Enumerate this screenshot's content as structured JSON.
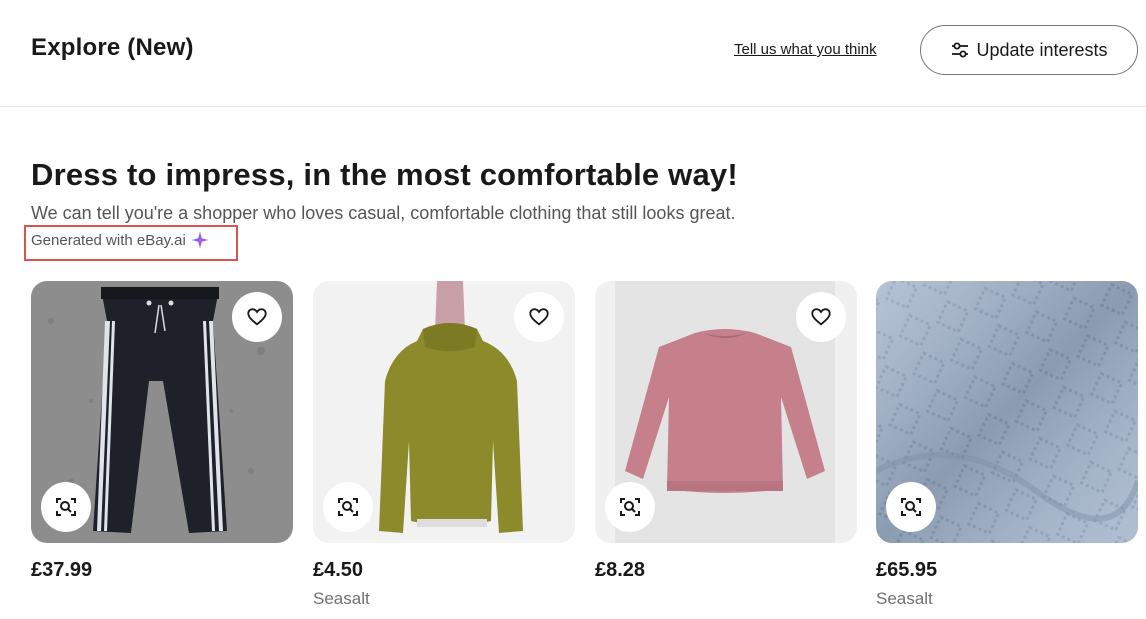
{
  "header": {
    "title": "Explore (New)",
    "feedback_link": "Tell us what you think",
    "update_button": "Update interests",
    "update_icon": "sliders-icon"
  },
  "section": {
    "headline": "Dress to impress, in the most comfortable way!",
    "subtext": "We can tell you're a shopper who loves casual, comfortable clothing that still looks great.",
    "generated": "Generated with eBay.ai",
    "generated_icon": "sparkle-icon"
  },
  "products": [
    {
      "name": "black track pants",
      "price": "£37.99",
      "seller": ""
    },
    {
      "name": "olive knit sweater",
      "price": "£4.50",
      "seller": "Seasalt"
    },
    {
      "name": "pink sweater",
      "price": "£8.28",
      "seller": ""
    },
    {
      "name": "blue knit fabric",
      "price": "£65.95",
      "seller": "Seasalt"
    }
  ],
  "colors": {
    "text": "#191919",
    "muted": "#707070",
    "highlight_box": "#d9534f",
    "sparkle_blue": "#4f7cf7",
    "sparkle_pink": "#e4458c"
  }
}
